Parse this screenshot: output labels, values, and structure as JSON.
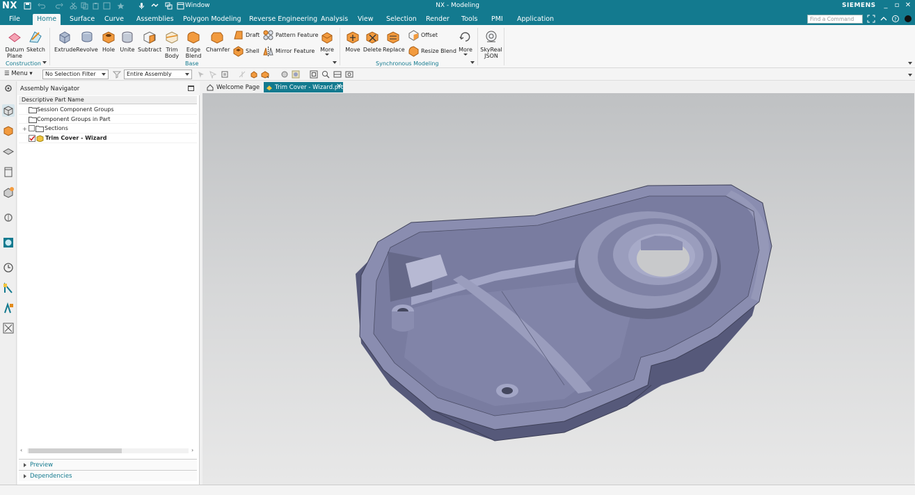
{
  "titlebar": {
    "logo": "NX",
    "window_menu": "Window",
    "title": "NX - Modeling",
    "brand": "SIEMENS"
  },
  "menubar": {
    "tabs": [
      "File",
      "Home",
      "Surface",
      "Curve",
      "Assemblies",
      "Polygon Modeling",
      "Reverse Engineering",
      "Analysis",
      "View",
      "Selection",
      "Render",
      "Tools",
      "PMI",
      "Application"
    ],
    "active_tab": "Home",
    "command_finder_placeholder": "Find a Command"
  },
  "ribbon": {
    "construction": {
      "group_label": "Construction",
      "datum_plane": "Datum Plane",
      "sketch": "Sketch"
    },
    "base": {
      "group_label": "Base",
      "extrude": "Extrude",
      "revolve": "Revolve",
      "hole": "Hole",
      "unite": "Unite",
      "subtract": "Subtract",
      "trim_body": "Trim Body",
      "edge_blend": "Edge Blend",
      "chamfer": "Chamfer",
      "draft": "Draft",
      "shell": "Shell",
      "pattern_feature": "Pattern Feature",
      "mirror_feature": "Mirror Feature",
      "more": "More"
    },
    "sync": {
      "group_label": "Synchronous Modeling",
      "move": "Move",
      "delete": "Delete",
      "replace": "Replace",
      "offset": "Offset",
      "resize_blend": "Resize Blend",
      "more": "More"
    },
    "skyreal": "SkyReal JSON"
  },
  "toolbar": {
    "menu": "Menu",
    "selection_filter": "No Selection Filter",
    "scope": "Entire Assembly"
  },
  "navigator": {
    "title": "Assembly Navigator",
    "column_header": "Descriptive Part Name",
    "rows": [
      {
        "label": "Session Component Groups"
      },
      {
        "label": "Component Groups in Part"
      },
      {
        "label": "Sections"
      },
      {
        "label": "Trim Cover - Wizard"
      }
    ],
    "preview": "Preview",
    "dependencies": "Dependencies"
  },
  "doc_tabs": {
    "welcome": "Welcome Page",
    "active": "Trim Cover - Wizard.prt"
  },
  "colors": {
    "accent": "#137a8f",
    "model": "#7c7fa1",
    "model_dark": "#56597a",
    "feature_orange": "#e8892f"
  }
}
